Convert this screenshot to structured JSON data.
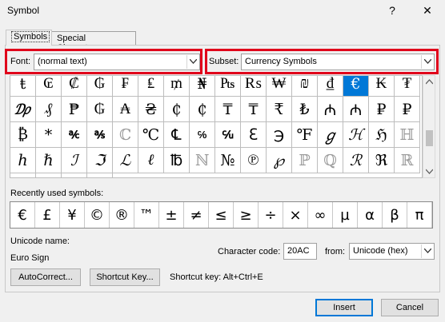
{
  "window": {
    "title": "Symbol",
    "help": "?",
    "close": "✕"
  },
  "tabs": [
    {
      "label": "Symbols"
    },
    {
      "label": "Special Characters"
    }
  ],
  "font": {
    "label": "Font:",
    "value": "(normal text)"
  },
  "subset": {
    "label": "Subset:",
    "value": "Currency Symbols"
  },
  "symbol_grid": [
    [
      "ŧ",
      "₢",
      "₡",
      "₲",
      "₣",
      "₤",
      "₥",
      "₦",
      "₧",
      "₨",
      "₩",
      "₪",
      "₫",
      "€",
      "₭",
      "₮",
      "₯"
    ],
    [
      "₰",
      "₱",
      "₲",
      "₳",
      "₴",
      "₵",
      "₵",
      "₸",
      "₸",
      "₹",
      "₺",
      "₼",
      "₼",
      "₽",
      "₽",
      "₿",
      "*"
    ],
    [
      "℀",
      "℁",
      "ℂ",
      "℃",
      "℄",
      "℅",
      "℆",
      "ℇ",
      "℈",
      "℉",
      "ℊ",
      "ℋ",
      "ℌ",
      "ℍ",
      "ℎ",
      "ℏ",
      "ℐ"
    ],
    [
      "ℑ",
      "ℒ",
      "ℓ",
      "℔",
      "ℕ",
      "№",
      "℗",
      "℘",
      "ℙ",
      "ℚ",
      "ℛ",
      "ℜ",
      "ℝ",
      "℞",
      "℟",
      "℠",
      "℡"
    ]
  ],
  "selected_symbol": "€",
  "recent": {
    "label": "Recently used symbols:",
    "symbols": [
      "€",
      "£",
      "¥",
      "©",
      "®",
      "™",
      "±",
      "≠",
      "≤",
      "≥",
      "÷",
      "×",
      "∞",
      "µ",
      "α",
      "β",
      "π"
    ]
  },
  "unicode": {
    "name_label": "Unicode name:",
    "name_value": "Euro Sign"
  },
  "char_code": {
    "label": "Character code:",
    "value": "20AC",
    "from_label": "from:",
    "from_value": "Unicode (hex)"
  },
  "buttons": {
    "autocorrect": "AutoCorrect...",
    "shortcut_key": "Shortcut Key...",
    "insert": "Insert",
    "cancel": "Cancel"
  },
  "shortcut_text": "Shortcut key: Alt+Ctrl+E",
  "colors": {
    "selection": "#0078d7",
    "highlight_box": "#e0001b"
  }
}
